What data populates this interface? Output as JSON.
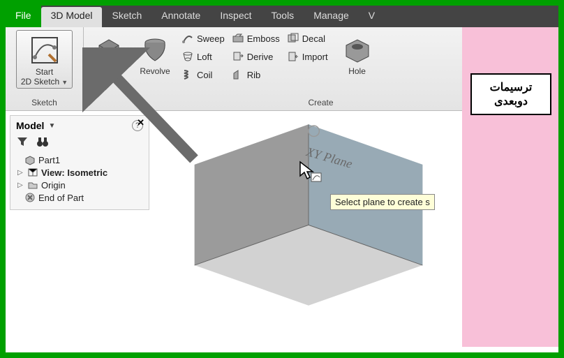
{
  "tabs": {
    "file": "File",
    "model3d": "3D Model",
    "sketch": "Sketch",
    "annotate": "Annotate",
    "inspect": "Inspect",
    "tools": "Tools",
    "manage": "Manage",
    "view": "V"
  },
  "ribbon": {
    "sketch_panel": "Sketch",
    "create_panel": "Create",
    "start_line1": "Start",
    "start_line2": "2D Sketch",
    "extrude": "Extrude",
    "revolve": "Revolve",
    "sweep": "Sweep",
    "loft": "Loft",
    "coil": "Coil",
    "emboss": "Emboss",
    "derive": "Derive",
    "rib": "Rib",
    "decal": "Decal",
    "import": "Import",
    "hole": "Hole"
  },
  "browser": {
    "title": "Model",
    "part": "Part1",
    "view": "View: Isometric",
    "origin": "Origin",
    "endofpart": "End of Part"
  },
  "viewport": {
    "plane_label": "XY Plane",
    "tooltip": "Select plane to create s"
  },
  "annotation": {
    "line1": "ترسیمات",
    "line2": "دوبعدی"
  }
}
